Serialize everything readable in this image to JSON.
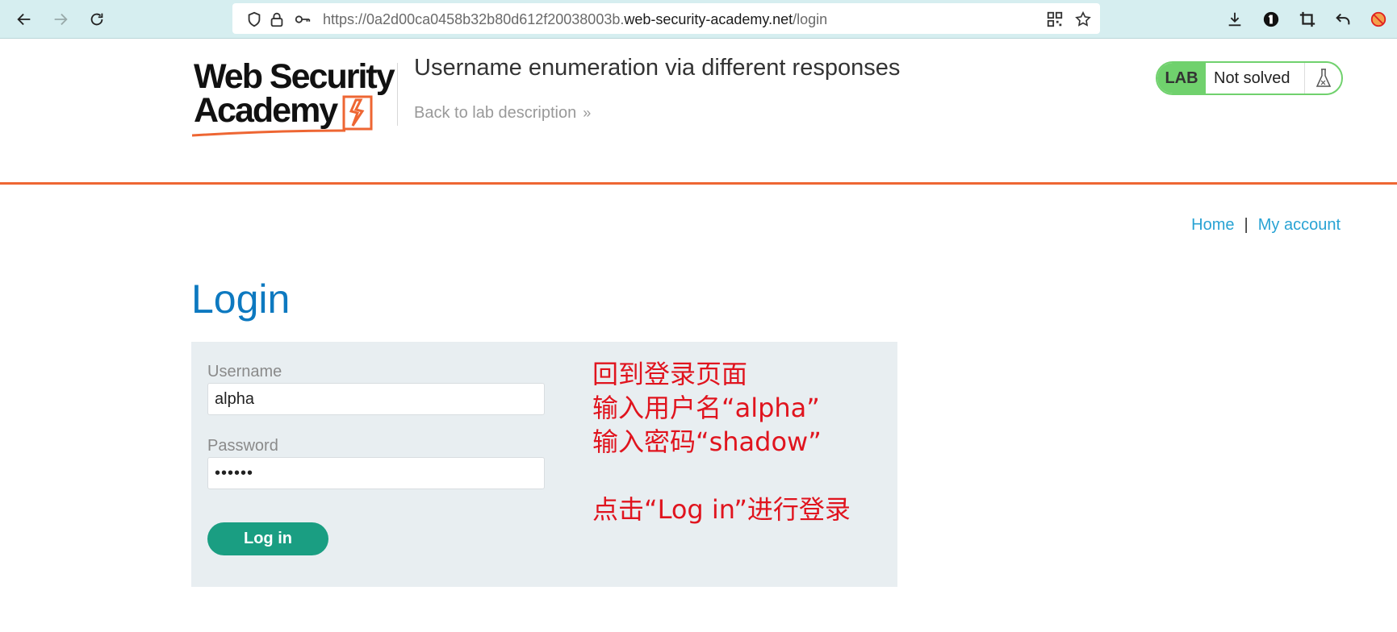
{
  "browser": {
    "url_prefix": "https://0a2d00ca0458b32b80d612f20038003b.",
    "url_domain": "web-security-academy.net",
    "url_path": "/login",
    "icons": [
      "back-icon",
      "forward-icon",
      "reload-icon",
      "shield-icon",
      "lock-icon",
      "key-icon",
      "qr-code-icon",
      "bookmark-star-icon",
      "download-icon",
      "password-manager-icon",
      "crop-icon",
      "undo-icon",
      "blocked-extension-icon"
    ]
  },
  "header": {
    "logo_line1": "Web Security",
    "logo_line2": "Academy",
    "lab_title": "Username enumeration via different responses",
    "back_link": "Back to lab description",
    "back_chevron": "»",
    "lab_label": "LAB",
    "lab_status": "Not solved",
    "accent_color": "#ee6633",
    "lab_badge_color": "#70d16d"
  },
  "nav": {
    "home": "Home",
    "separator": "|",
    "my_account": "My account"
  },
  "login": {
    "title": "Login",
    "username_label": "Username",
    "username_value": "alpha",
    "password_label": "Password",
    "password_value": "••••••",
    "submit_label": "Log in",
    "button_color": "#1a9e82"
  },
  "annotation": {
    "line1": "回到登录页面",
    "line2": "输入用户名“alpha”",
    "line3": "输入密码“shadow”",
    "line4": "点击“Log in”进行登录",
    "color": "#e0141e"
  }
}
